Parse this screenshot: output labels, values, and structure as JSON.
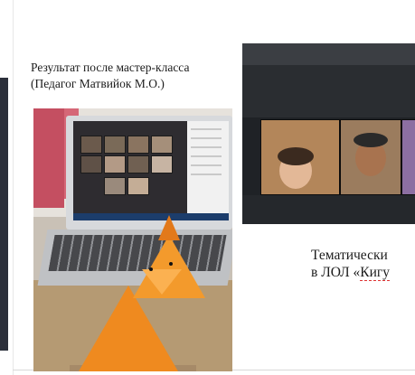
{
  "slide": {
    "caption_left_line1": "Результат после мастер-класса",
    "caption_left_line2": "(Педагог  Матвийок М.О.)",
    "caption_right_line1": "Тематически",
    "caption_right_line2_prefix": "в ЛОЛ «",
    "caption_right_line2_word": "Кигу"
  },
  "colors": {
    "fox": "#ef8a1f",
    "curtain": "#c44f61",
    "taskbar": "#1c3d6b"
  }
}
